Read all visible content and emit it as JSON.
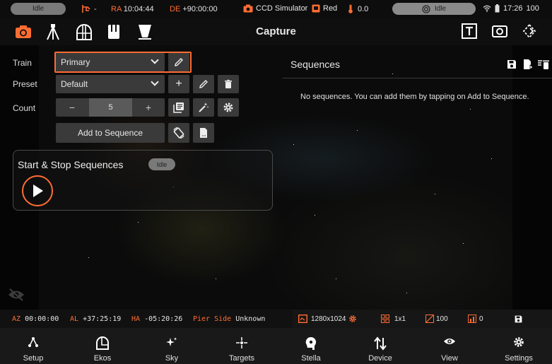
{
  "status_bar": {
    "mount_state": "Idle",
    "mount_dash": "-",
    "ra_label": "RA",
    "ra_value": "10:04:44",
    "de_label": "DE",
    "de_value": "+90:00:00",
    "camera": "CCD Simulator",
    "filter": "Red",
    "temperature": "0.0",
    "guide_state": "Idle",
    "clock": "17:26",
    "battery": "100"
  },
  "toolbar": {
    "title": "Capture"
  },
  "capture_form": {
    "train_label": "Train",
    "train_value": "Primary",
    "preset_label": "Preset",
    "preset_value": "Default",
    "count_label": "Count",
    "count_minus": "−",
    "count_value": "5",
    "count_plus": "+",
    "add_to_sequence": "Add to Sequence",
    "add_icon_glyph": "+"
  },
  "start_stop": {
    "title": "Start & Stop Sequences",
    "state": "Idle"
  },
  "sequences": {
    "title": "Sequences",
    "empty_message": "No sequences. You can add them by tapping on Add to Sequence."
  },
  "info_bar": {
    "az_label": "AZ",
    "az_value": "00:00:00",
    "al_label": "AL",
    "al_value": "+37:25:19",
    "ha_label": "HA",
    "ha_value": "-05:20:26",
    "pier_label": "Pier Side",
    "pier_value": "Unknown",
    "resolution": "1280x1024",
    "binning": "1x1",
    "gain": "100",
    "offset": "0"
  },
  "bottom_nav": [
    {
      "label": "Setup",
      "icon": "setup-icon"
    },
    {
      "label": "Ekos",
      "icon": "ekos-icon"
    },
    {
      "label": "Sky",
      "icon": "sky-icon"
    },
    {
      "label": "Targets",
      "icon": "targets-icon"
    },
    {
      "label": "Stella",
      "icon": "stella-icon"
    },
    {
      "label": "Device",
      "icon": "device-icon"
    },
    {
      "label": "View",
      "icon": "view-icon"
    },
    {
      "label": "Settings",
      "icon": "settings-icon"
    }
  ],
  "colors": {
    "accent": "#ff6d33",
    "panel": "#3a3a3a",
    "background": "#050505"
  }
}
